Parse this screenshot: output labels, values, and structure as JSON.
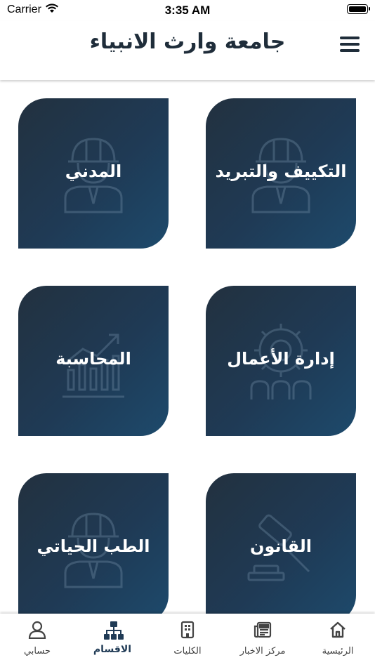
{
  "status_bar": {
    "carrier": "Carrier",
    "time": "3:35 AM"
  },
  "header": {
    "title": "جامعة وارث الانبياء"
  },
  "departments": [
    {
      "label": "التكييف والتبريد",
      "icon": "engineer-icon"
    },
    {
      "label": "المدني",
      "icon": "engineer-icon"
    },
    {
      "label": "إدارة الأعمال",
      "icon": "gear-people-icon"
    },
    {
      "label": "المحاسبة",
      "icon": "chart-growth-icon"
    },
    {
      "label": "القانون",
      "icon": "gavel-icon"
    },
    {
      "label": "الطب الحياتي",
      "icon": "engineer-icon"
    }
  ],
  "tab_bar": {
    "tabs": [
      {
        "label": "الرئيسية",
        "icon": "home-icon"
      },
      {
        "label": "مركز الاخبار",
        "icon": "newspaper-icon"
      },
      {
        "label": "الكليات",
        "icon": "building-icon"
      },
      {
        "label": "الاقسام",
        "icon": "sitemap-icon"
      },
      {
        "label": "حسابي",
        "icon": "user-icon"
      }
    ],
    "active": "الاقسام",
    "active_color": "#1f3a55"
  },
  "colors": {
    "card_dark": "#22313f",
    "card_light": "#1d4a6c",
    "title": "#1f2d3a"
  }
}
